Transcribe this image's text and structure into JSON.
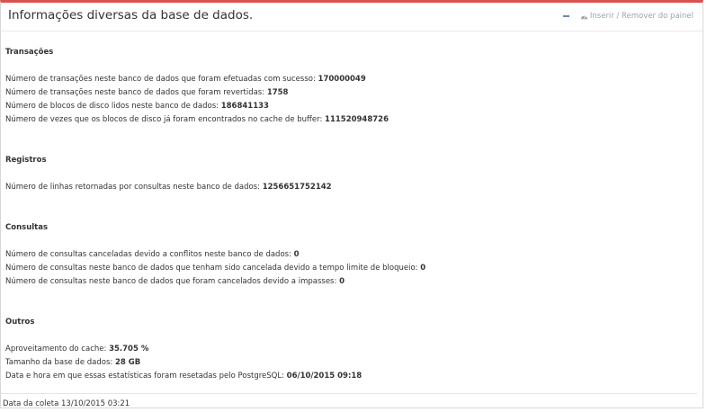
{
  "panel": {
    "title": "Informações diversas da base de dados.",
    "tools_label": "Inserir / Remover do painel",
    "accent_color": "#d9534f"
  },
  "sections": {
    "transacoes": {
      "title": "Transações",
      "lines": [
        {
          "label": "Número de transações neste banco de dados que foram efetuadas com sucesso:",
          "value": "170000049"
        },
        {
          "label": "Número de transações neste banco de dados que foram revertidas:",
          "value": "1758"
        },
        {
          "label": "Número de blocos de disco lidos neste banco de dados:",
          "value": "186841133"
        },
        {
          "label": "Número de vezes que os blocos de disco já foram encontrados no cache de buffer:",
          "value": "111520948726"
        }
      ]
    },
    "registros": {
      "title": "Registros",
      "lines": [
        {
          "label": "Número de linhas retornadas por consultas neste banco de dados:",
          "value": "1256651752142"
        }
      ]
    },
    "consultas": {
      "title": "Consultas",
      "lines": [
        {
          "label": "Número de consultas canceladas devido a conflitos neste banco de dados:",
          "value": "0"
        },
        {
          "label": "Número de consultas neste banco de dados que tenham sido cancelada devido a tempo limite de bloqueio:",
          "value": "0"
        },
        {
          "label": "Número de consultas neste banco de dados que foram cancelados devido a impasses:",
          "value": "0"
        }
      ]
    },
    "outros": {
      "title": "Outros",
      "lines": [
        {
          "label": "Aproveitamento do cache:",
          "value": "35.705 %"
        },
        {
          "label": "Tamanho da base de dados:",
          "value": "28 GB"
        },
        {
          "label": "Data e hora em que essas estatísticas foram resetadas pelo PostgreSQL:",
          "value": "06/10/2015 09:18"
        }
      ]
    }
  },
  "footer": {
    "text": "Data da coleta 13/10/2015 03:21"
  }
}
